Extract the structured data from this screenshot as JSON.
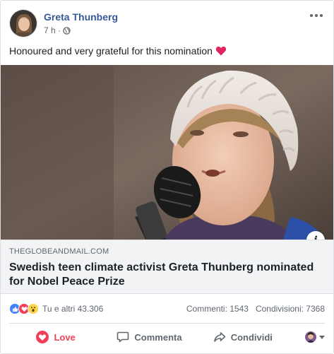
{
  "post": {
    "author": "Greta Thunberg",
    "timestamp": "7 h ·",
    "privacy_icon": "globe-icon",
    "message": "Honoured and very grateful for this nomination",
    "message_emoji": "red-heart-icon"
  },
  "link": {
    "domain": "THEGLOBEANDMAIL.COM",
    "title": "Swedish teen climate activist Greta Thunberg nominated for Nobel Peace Prize",
    "info_label": "i"
  },
  "reactions": {
    "icons": [
      "like-icon",
      "love-icon",
      "wow-icon"
    ],
    "summary": "Tu e altri 43.306",
    "comments": "Commenti: 1543",
    "shares": "Condivisioni: 7368"
  },
  "actions": {
    "love": "Love",
    "comment": "Commenta",
    "share": "Condividi"
  },
  "colors": {
    "author_link": "#385898",
    "love_active": "#f33e58",
    "like_blue": "#4080ff",
    "muted_text": "#606770",
    "card_bg": "#f2f3f5"
  }
}
